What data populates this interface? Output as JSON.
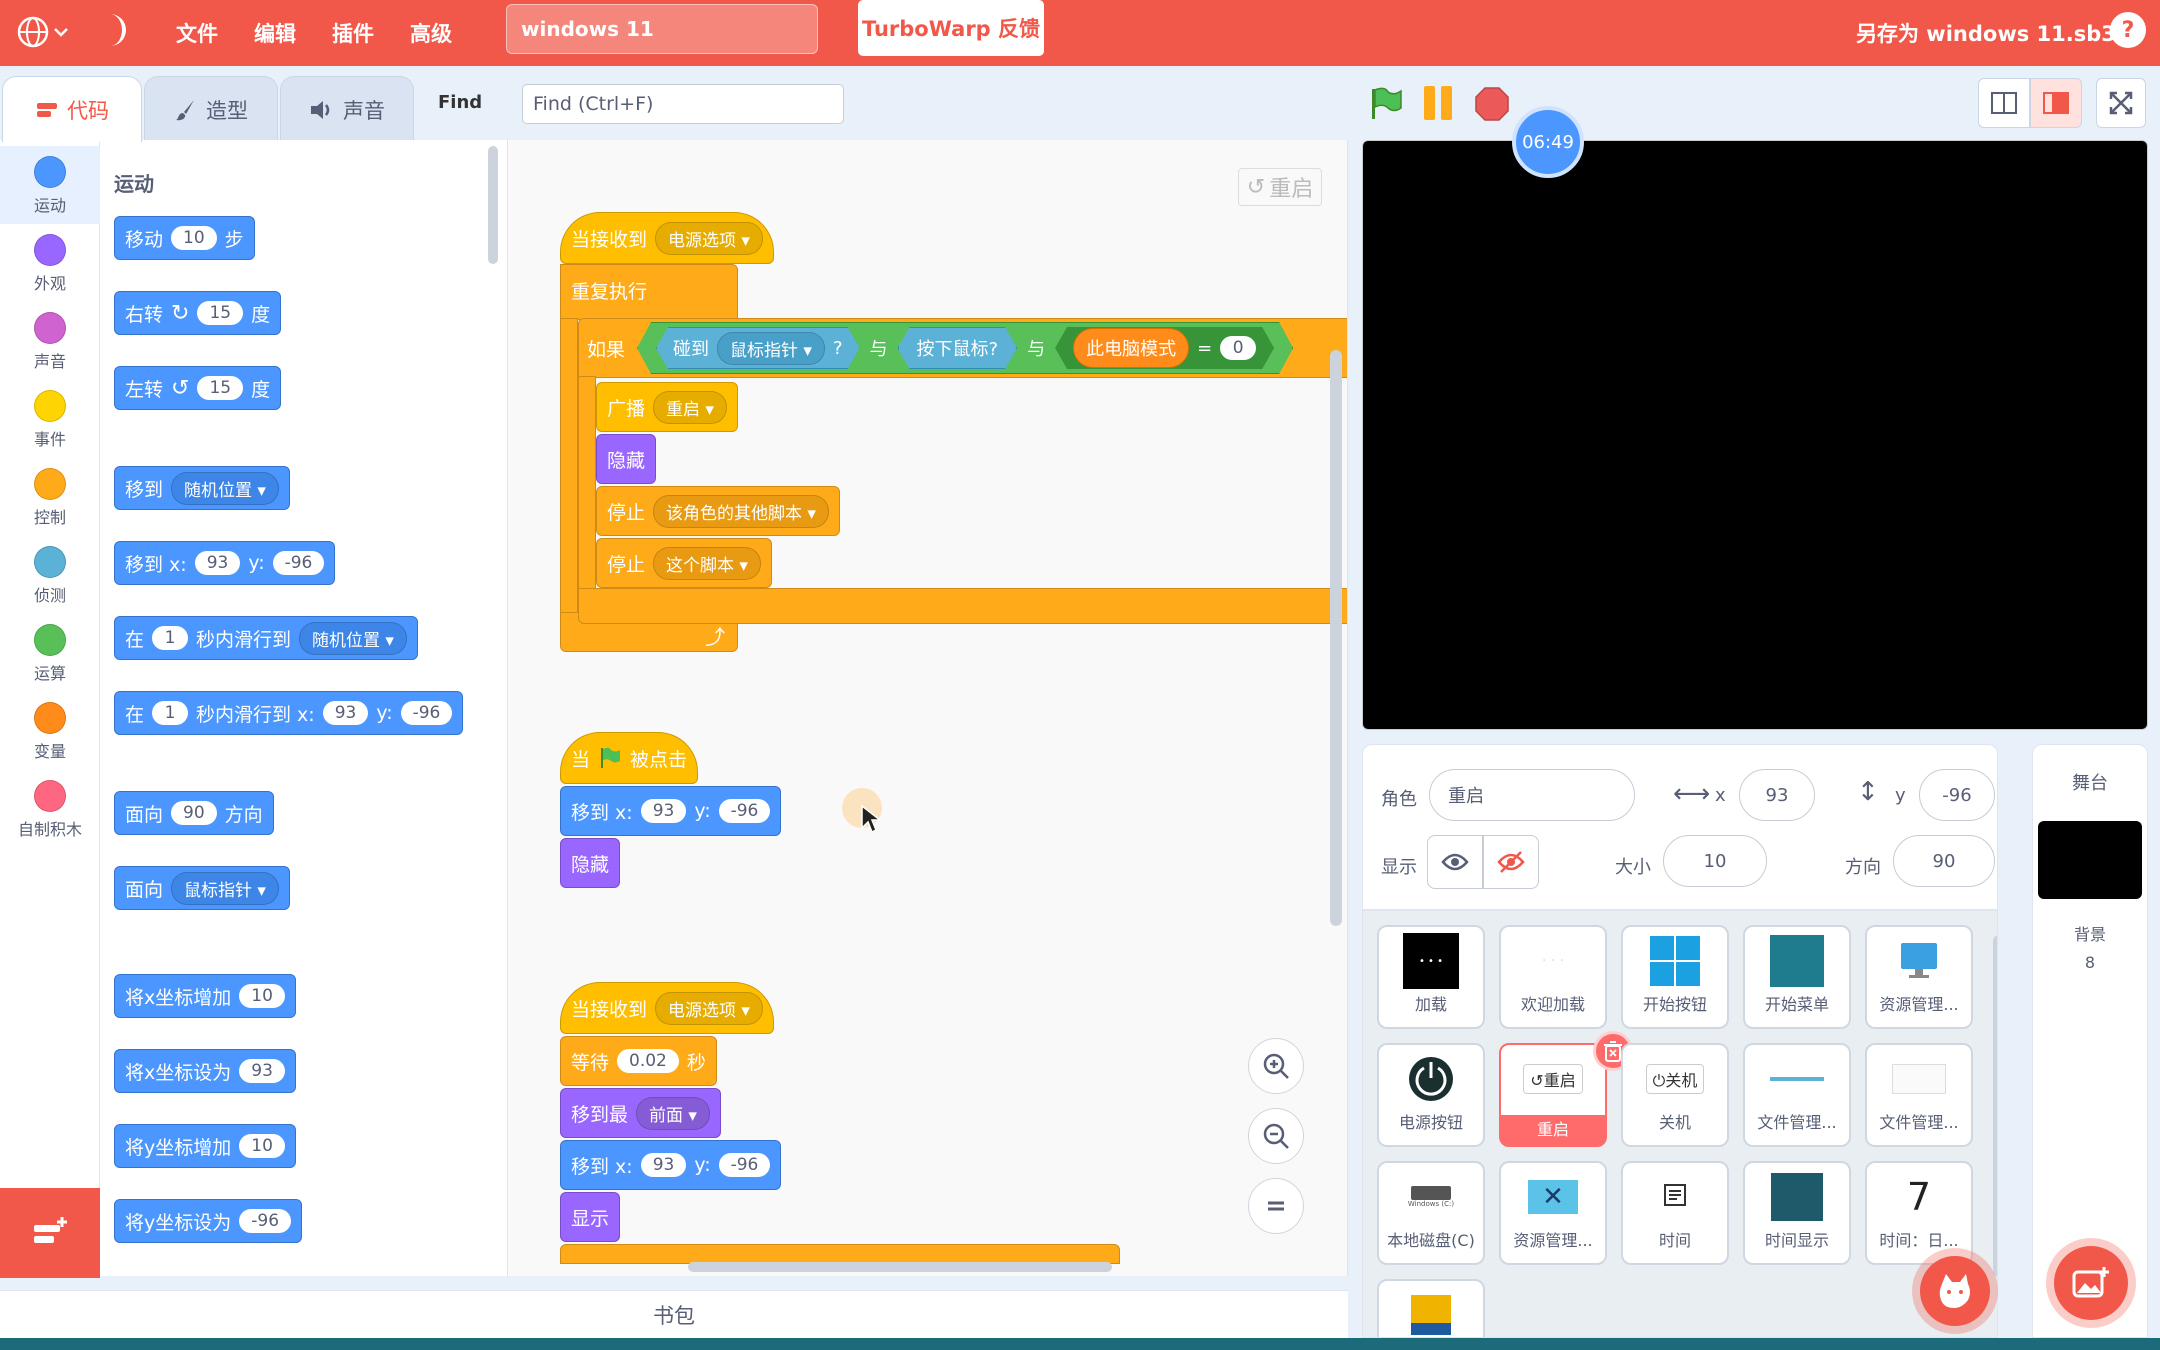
{
  "menubar": {
    "items": [
      "文件",
      "编辑",
      "插件",
      "高级"
    ],
    "project_title": "windows 11",
    "feedback_button": "TurboWarp 反馈",
    "save_as": "另存为 windows 11.sb3",
    "help": "?"
  },
  "tabs": {
    "code": "代码",
    "costumes": "造型",
    "sounds": "声音"
  },
  "find": {
    "label": "Find",
    "placeholder": "Find (Ctrl+F)"
  },
  "categories": [
    {
      "label": "运动",
      "color": "#4c97ff"
    },
    {
      "label": "外观",
      "color": "#9966ff"
    },
    {
      "label": "声音",
      "color": "#cf63cf"
    },
    {
      "label": "事件",
      "color": "#ffd500"
    },
    {
      "label": "控制",
      "color": "#ffab19"
    },
    {
      "label": "侦测",
      "color": "#5cb1d6"
    },
    {
      "label": "运算",
      "color": "#59c059"
    },
    {
      "label": "变量",
      "color": "#ff8c1a"
    },
    {
      "label": "自制积木",
      "color": "#ff6680"
    }
  ],
  "palette": {
    "heading": "运动",
    "move": {
      "a": "移动",
      "v": "10",
      "b": "步"
    },
    "turn_right": {
      "a": "右转",
      "v": "15",
      "b": "度"
    },
    "turn_left": {
      "a": "左转",
      "v": "15",
      "b": "度"
    },
    "goto": {
      "a": "移到",
      "dd": "随机位置"
    },
    "goto_xy": {
      "a": "移到 x:",
      "x": "93",
      "yl": "y:",
      "y": "-96"
    },
    "glide": {
      "a": "在",
      "v": "1",
      "b": "秒内滑行到",
      "dd": "随机位置"
    },
    "glide_xy": {
      "a": "在",
      "v": "1",
      "b": "秒内滑行到 x:",
      "x": "93",
      "yl": "y:",
      "y": "-96"
    },
    "point_dir": {
      "a": "面向",
      "v": "90",
      "b": "方向"
    },
    "point_towards": {
      "a": "面向",
      "dd": "鼠标指针"
    },
    "change_x": {
      "a": "将x坐标增加",
      "v": "10"
    },
    "set_x": {
      "a": "将x坐标设为",
      "v": "93"
    },
    "change_y": {
      "a": "将y坐标增加",
      "v": "10"
    },
    "set_y": {
      "a": "将y坐标设为",
      "v": "-96"
    }
  },
  "script": {
    "cleanup": "重启",
    "s1": {
      "hat": "当接收到",
      "hat_dd": "电源选项",
      "forever": "重复执行",
      "if": "如果",
      "touching": "碰到",
      "touching_dd": "鼠标指针",
      "q": "?",
      "and1": "与",
      "mouse_down": "按下鼠标?",
      "and2": "与",
      "var": "此电脑模式",
      "eq": "=",
      "eq_val": "0",
      "broadcast": "广播",
      "broadcast_dd": "重启",
      "hide": "隐藏",
      "stop1": "停止",
      "stop1_dd": "该角色的其他脚本",
      "stop2": "停止",
      "stop2_dd": "这个脚本"
    },
    "s2": {
      "hat_a": "当",
      "hat_b": "被点击",
      "goto": "移到 x:",
      "x": "93",
      "yl": "y:",
      "y": "-96",
      "hide": "隐藏"
    },
    "s3": {
      "hat": "当接收到",
      "hat_dd": "电源选项",
      "wait": "等待",
      "wait_v": "0.02",
      "wait_b": "秒",
      "front": "移到最",
      "front_dd": "前面",
      "goto": "移到 x:",
      "x": "93",
      "yl": "y:",
      "y": "-96",
      "show": "显示"
    }
  },
  "backpack": "书包",
  "timer": "06:49",
  "sprite_info": {
    "sprite_label": "角色",
    "sprite_name": "重启",
    "x_label": "x",
    "x": "93",
    "y_label": "y",
    "y": "-96",
    "show_label": "显示",
    "size_label": "大小",
    "size": "10",
    "dir_label": "方向",
    "dir": "90"
  },
  "sprites": [
    "加载",
    "欢迎加载",
    "开始按钮",
    "开始菜单",
    "资源管理...",
    "电源按钮",
    "重启",
    "关机",
    "文件管理...",
    "文件管理...",
    "本地磁盘(C)",
    "资源管理...",
    "时间",
    "时间显示",
    "时间：日..."
  ],
  "sprite_thumb_text": {
    "restart": "重启",
    "shutdown": "关机",
    "seven": "7",
    "win_c": "Windows (C:)"
  },
  "stage_panel": {
    "title": "舞台",
    "backdrops_label": "背景",
    "backdrops_count": "8"
  }
}
